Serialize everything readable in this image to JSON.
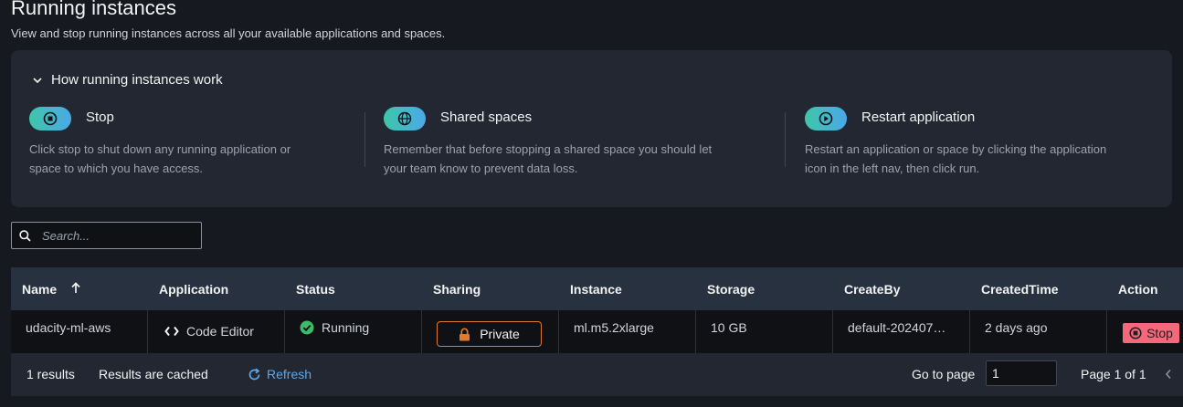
{
  "header": {
    "title": "Running instances",
    "subtitle": "View and stop running instances across all your available applications and spaces."
  },
  "info": {
    "toggle_label": "How running instances work",
    "columns": [
      {
        "icon": "stop-icon",
        "title": "Stop",
        "text_line1": "Click stop to shut down any running application or",
        "text_line2": "space to which you have access."
      },
      {
        "icon": "globe-icon",
        "title": "Shared spaces",
        "text_line1": "Remember that before stopping a shared space you should let",
        "text_line2": "your team know to prevent data loss."
      },
      {
        "icon": "play-circle-icon",
        "title": "Restart application",
        "text_line1": "Restart an application or space by clicking the application",
        "text_line2": "icon in the left nav, then click run."
      }
    ]
  },
  "search": {
    "placeholder": "Search...",
    "value": ""
  },
  "table": {
    "columns": [
      "Name",
      "Application",
      "Status",
      "Sharing",
      "Instance",
      "Storage",
      "CreateBy",
      "CreatedTime",
      "Action"
    ],
    "rows": [
      {
        "name": "udacity-ml-aws",
        "application": "Code Editor",
        "status": "Running",
        "sharing": "Private",
        "instance": "ml.m5.2xlarge",
        "storage": "10 GB",
        "create_by": "default-202407…",
        "created_time": "2 days ago",
        "action": "Stop"
      }
    ]
  },
  "footer": {
    "results": "1 results",
    "cached": "Results are cached",
    "refresh": "Refresh",
    "go_to_page": "Go to page",
    "page_value": "1",
    "page_of": "Page 1 of 1"
  },
  "colors": {
    "accent_orange": "#e07a2f",
    "stop_red": "#f4687a",
    "link_blue": "#5fa8e8",
    "running_green": "#3fba6b"
  }
}
